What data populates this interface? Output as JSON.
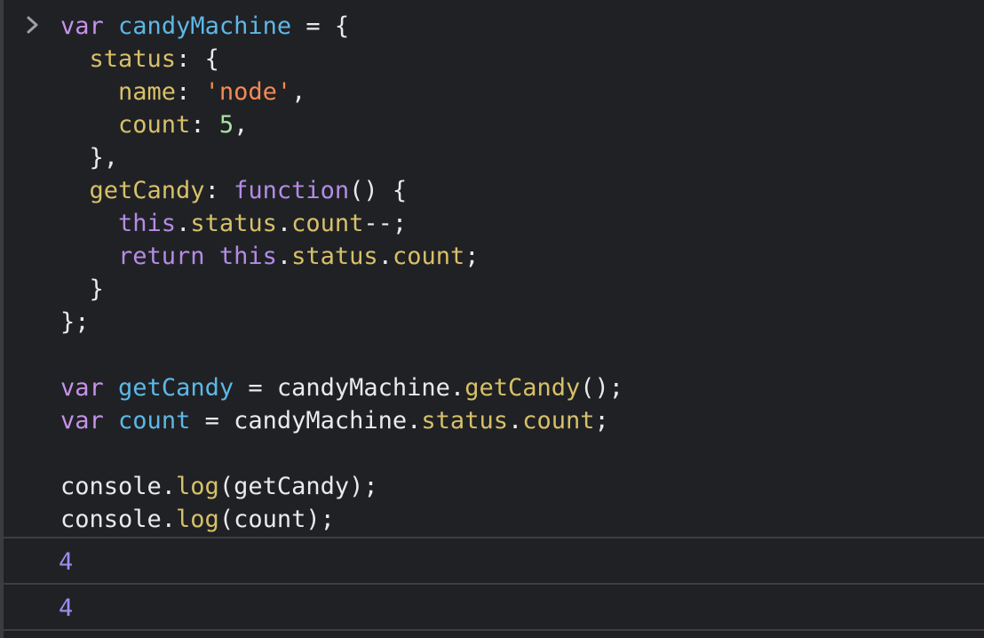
{
  "console": {
    "prompt_icon": "chevron-right-icon",
    "code_lines": [
      {
        "tokens": [
          {
            "t": "var",
            "c": "kw"
          },
          {
            "t": " ",
            "c": "pl"
          },
          {
            "t": "candyMachine",
            "c": "id"
          },
          {
            "t": " = {",
            "c": "pl"
          }
        ]
      },
      {
        "tokens": [
          {
            "t": "  ",
            "c": "pl"
          },
          {
            "t": "status",
            "c": "prop"
          },
          {
            "t": ": {",
            "c": "pl"
          }
        ]
      },
      {
        "tokens": [
          {
            "t": "    ",
            "c": "pl"
          },
          {
            "t": "name",
            "c": "prop"
          },
          {
            "t": ": ",
            "c": "pl"
          },
          {
            "t": "'node'",
            "c": "str"
          },
          {
            "t": ",",
            "c": "pl"
          }
        ]
      },
      {
        "tokens": [
          {
            "t": "    ",
            "c": "pl"
          },
          {
            "t": "count",
            "c": "prop"
          },
          {
            "t": ": ",
            "c": "pl"
          },
          {
            "t": "5",
            "c": "num"
          },
          {
            "t": ",",
            "c": "pl"
          }
        ]
      },
      {
        "tokens": [
          {
            "t": "  },",
            "c": "pl"
          }
        ]
      },
      {
        "tokens": [
          {
            "t": "  ",
            "c": "pl"
          },
          {
            "t": "getCandy",
            "c": "prop"
          },
          {
            "t": ": ",
            "c": "pl"
          },
          {
            "t": "function",
            "c": "kw2"
          },
          {
            "t": "() {",
            "c": "pl"
          }
        ]
      },
      {
        "tokens": [
          {
            "t": "    ",
            "c": "pl"
          },
          {
            "t": "this",
            "c": "kw2"
          },
          {
            "t": ".",
            "c": "pl"
          },
          {
            "t": "status",
            "c": "prop"
          },
          {
            "t": ".",
            "c": "pl"
          },
          {
            "t": "count",
            "c": "prop"
          },
          {
            "t": "--;",
            "c": "pl"
          }
        ]
      },
      {
        "tokens": [
          {
            "t": "    ",
            "c": "pl"
          },
          {
            "t": "return",
            "c": "kw2"
          },
          {
            "t": " ",
            "c": "pl"
          },
          {
            "t": "this",
            "c": "kw2"
          },
          {
            "t": ".",
            "c": "pl"
          },
          {
            "t": "status",
            "c": "prop"
          },
          {
            "t": ".",
            "c": "pl"
          },
          {
            "t": "count",
            "c": "prop"
          },
          {
            "t": ";",
            "c": "pl"
          }
        ]
      },
      {
        "tokens": [
          {
            "t": "  }",
            "c": "pl"
          }
        ]
      },
      {
        "tokens": [
          {
            "t": "};",
            "c": "pl"
          }
        ]
      },
      {
        "tokens": [
          {
            "t": "",
            "c": "pl"
          }
        ]
      },
      {
        "tokens": [
          {
            "t": "var",
            "c": "kw"
          },
          {
            "t": " ",
            "c": "pl"
          },
          {
            "t": "getCandy",
            "c": "id"
          },
          {
            "t": " = candyMachine.",
            "c": "pl"
          },
          {
            "t": "getCandy",
            "c": "fn"
          },
          {
            "t": "();",
            "c": "pl"
          }
        ]
      },
      {
        "tokens": [
          {
            "t": "var",
            "c": "kw"
          },
          {
            "t": " ",
            "c": "pl"
          },
          {
            "t": "count",
            "c": "id"
          },
          {
            "t": " = candyMachine.",
            "c": "pl"
          },
          {
            "t": "status",
            "c": "prop"
          },
          {
            "t": ".",
            "c": "pl"
          },
          {
            "t": "count",
            "c": "prop"
          },
          {
            "t": ";",
            "c": "pl"
          }
        ]
      },
      {
        "tokens": [
          {
            "t": "",
            "c": "pl"
          }
        ]
      },
      {
        "tokens": [
          {
            "t": "console.",
            "c": "pl"
          },
          {
            "t": "log",
            "c": "fn"
          },
          {
            "t": "(getCandy);",
            "c": "pl"
          }
        ]
      },
      {
        "tokens": [
          {
            "t": "console.",
            "c": "pl"
          },
          {
            "t": "log",
            "c": "fn"
          },
          {
            "t": "(count);",
            "c": "pl"
          }
        ]
      }
    ],
    "outputs": [
      "4",
      "4"
    ]
  },
  "colors": {
    "background": "#202124",
    "keyword": "#c792ea",
    "identifier": "#5cb8e8",
    "property": "#d7c069",
    "string": "#f28b54",
    "number": "#a6e3a1",
    "output_number": "#9d8cf0"
  }
}
